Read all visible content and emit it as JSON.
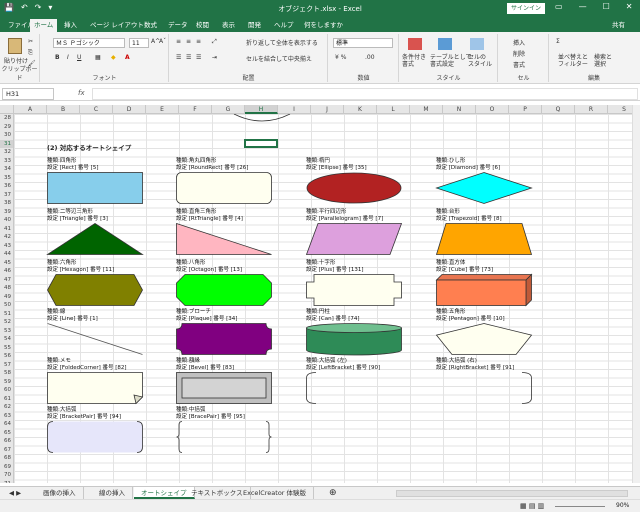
{
  "titlebar": {
    "title": "オブジェクト.xlsx - Excel",
    "signin": "サインイン",
    "qat": [
      "💾",
      "↶",
      "↷",
      "▾"
    ],
    "controls": [
      "▭",
      "—",
      "☐",
      "✕"
    ]
  },
  "tabs": [
    "ファイル",
    "ホーム",
    "挿入",
    "ページ レイアウト",
    "数式",
    "データ",
    "校閲",
    "表示",
    "開発",
    "ヘルプ",
    "何をしますか",
    "共有"
  ],
  "ribbon": {
    "clipboard": {
      "paste": "貼り付け",
      "label": "クリップボード"
    },
    "font": {
      "name": "ＭＳ Ｐゴシック",
      "size": "11",
      "label": "フォント",
      "bold": "B",
      "italic": "I",
      "underline": "U",
      "grow": "A^",
      "shrink": "Aˇ"
    },
    "alignment": {
      "wrap": "折り返して全体を表示する",
      "merge": "セルを結合して中央揃え",
      "label": "配置"
    },
    "number": {
      "format": "標準",
      "label": "数値"
    },
    "styles": {
      "cond": "条件付き\n書式",
      "table": "テーブルとして\n書式設定",
      "cell": "セルの\nスタイル",
      "label": "スタイル"
    },
    "cells": {
      "insert": "挿入",
      "delete": "削除",
      "format": "書式",
      "label": "セル"
    },
    "editing": {
      "sort": "並べ替えと\nフィルター",
      "find": "検索と\n選択",
      "label": "編集"
    }
  },
  "formula": {
    "namebox": "H31",
    "fx": "fx",
    "value": ""
  },
  "columns": [
    "A",
    "B",
    "C",
    "D",
    "E",
    "F",
    "G",
    "H",
    "I",
    "J",
    "K",
    "L",
    "M",
    "N",
    "O",
    "P",
    "Q",
    "R",
    "S"
  ],
  "selected_column": "H",
  "selected_row": "31",
  "rows": [
    "28",
    "29",
    "30",
    "31",
    "32",
    "33",
    "34",
    "35",
    "36",
    "37",
    "38",
    "39",
    "40",
    "41",
    "42",
    "43",
    "44",
    "45",
    "46",
    "47",
    "48",
    "49",
    "50",
    "51",
    "52",
    "53",
    "54",
    "55",
    "56",
    "57",
    "58",
    "59",
    "60",
    "61",
    "62",
    "63",
    "64",
    "65",
    "66",
    "67",
    "68",
    "69",
    "70",
    "71",
    "72",
    "73"
  ],
  "section_title": "(2) 対応するオートシェイプ",
  "shapes": [
    {
      "l1": "種類:四角形",
      "l2": "設定 [Rect] 番号 [5]",
      "color": "#87ceeb",
      "kind": "rect"
    },
    {
      "l1": "種類:角丸四角形",
      "l2": "設定 [RoundRect] 番号 [26]",
      "color": "#fffff0",
      "kind": "roundrect"
    },
    {
      "l1": "種類:楕円",
      "l2": "設定 [Ellipse] 番号 [35]",
      "color": "#b22222",
      "kind": "ellipse"
    },
    {
      "l1": "種類:ひし形",
      "l2": "設定 [Diamond] 番号 [6]",
      "color": "#00ffff",
      "kind": "diamond"
    },
    {
      "l1": "種類:二等辺三角形",
      "l2": "設定 [Triangle] 番号 [3]",
      "color": "#006400",
      "kind": "triangle"
    },
    {
      "l1": "種類:直角三角形",
      "l2": "設定 [RtTriangle] 番号 [4]",
      "color": "#ffb6c1",
      "kind": "rttriangle"
    },
    {
      "l1": "種類:平行四辺形",
      "l2": "設定 [Parallelogram] 番号 [7]",
      "color": "#dda0dd",
      "kind": "parallelogram"
    },
    {
      "l1": "種類:台形",
      "l2": "設定 [Trapezoid] 番号 [8]",
      "color": "#ffa500",
      "kind": "trapezoid"
    },
    {
      "l1": "種類:六角形",
      "l2": "設定 [Hexagon] 番号 [11]",
      "color": "#808000",
      "kind": "hexagon"
    },
    {
      "l1": "種類:八角形",
      "l2": "設定 [Octagon] 番号 [13]",
      "color": "#00ff00",
      "kind": "octagon"
    },
    {
      "l1": "種類:十字形",
      "l2": "設定 [Plus] 番号 [131]",
      "color": "#fffff0",
      "kind": "plus"
    },
    {
      "l1": "種類:直方体",
      "l2": "設定 [Cube] 番号 [73]",
      "color": "#ff7f50",
      "kind": "cube"
    },
    {
      "l1": "種類:線",
      "l2": "設定 [Line] 番号 [1]",
      "color": "#555555",
      "kind": "line"
    },
    {
      "l1": "種類:ブローチ",
      "l2": "設定 [Plaque] 番号 [34]",
      "color": "#800080",
      "kind": "plaque"
    },
    {
      "l1": "種類:円柱",
      "l2": "設定 [Can] 番号 [74]",
      "color": "#2e8b57",
      "kind": "can"
    },
    {
      "l1": "種類:五角形",
      "l2": "設定 [Pentagon] 番号 [10]",
      "color": "#fffff0",
      "kind": "pentagon"
    },
    {
      "l1": "種類:メモ",
      "l2": "設定 [FoldedCorner] 番号 [82]",
      "color": "#fffff0",
      "kind": "folded"
    },
    {
      "l1": "種類:額縁",
      "l2": "設定 [Bevel] 番号 [83]",
      "color": "#c0c0c0",
      "kind": "bevel"
    },
    {
      "l1": "種類:大括弧 (左)",
      "l2": "設定 [LeftBracket] 番号 [90]",
      "color": "#ffffff",
      "kind": "lbracket"
    },
    {
      "l1": "種類:大括弧 (右)",
      "l2": "設定 [RightBracket] 番号 [91]",
      "color": "#ffffff",
      "kind": "rbracket"
    },
    {
      "l1": "種類:大括弧",
      "l2": "設定 [BracketPair] 番号 [94]",
      "color": "#e6e6fa",
      "kind": "bracketpair"
    },
    {
      "l1": "種類:中括弧",
      "l2": "設定 [BracePair] 番号 [95]",
      "color": "#ffffff",
      "kind": "bracepair"
    }
  ],
  "sheets": [
    "画像の挿入",
    "線の挿入",
    "オートシェイプ",
    "テキストボックス",
    "ExcelCreator 体験版"
  ],
  "active_sheet": 2,
  "zoom": "90%"
}
